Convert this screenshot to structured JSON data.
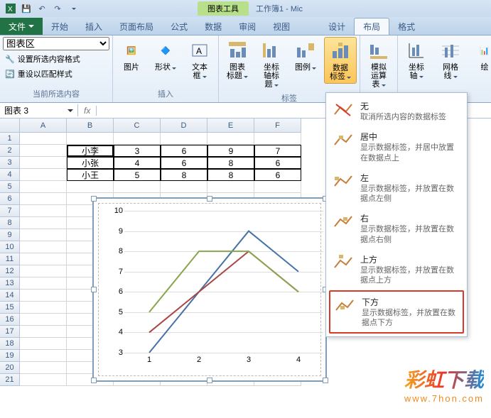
{
  "title": {
    "chart_tools": "图表工具",
    "workbook": "工作簿1 - Mic"
  },
  "tabs": {
    "file": "文件",
    "main": [
      "开始",
      "插入",
      "页面布局",
      "公式",
      "数据",
      "审阅",
      "视图"
    ],
    "chart": [
      "设计",
      "布局",
      "格式"
    ],
    "active": "布局"
  },
  "ribbon": {
    "sel": {
      "area": "图表区",
      "fmt": "设置所选内容格式",
      "reset": "重设以匹配样式",
      "label": "当前所选内容"
    },
    "insert": {
      "pic": "图片",
      "shape": "形状",
      "textbox": "文本框",
      "label": "插入"
    },
    "labels": {
      "title": "图表标题",
      "axistitle": "坐标轴标题",
      "legend": "图例",
      "datalabels": "数据标签",
      "label": "标签"
    },
    "analysis": {
      "table": "模拟运算表"
    },
    "axes": {
      "axis": "坐标轴",
      "grid": "网格线",
      "draw": "绘"
    }
  },
  "formula": {
    "namebox": "图表 3",
    "fx": "fx"
  },
  "cols": [
    "A",
    "B",
    "C",
    "D",
    "E",
    "F"
  ],
  "rows": [
    1,
    2,
    3,
    4,
    5,
    6,
    7,
    8,
    9,
    10,
    11,
    12,
    13,
    14,
    15,
    16,
    17,
    18,
    19,
    20,
    21
  ],
  "table": {
    "r2": [
      "",
      "小李",
      "3",
      "6",
      "9",
      "7"
    ],
    "r3": [
      "",
      "小张",
      "4",
      "6",
      "8",
      "6"
    ],
    "r4": [
      "",
      "小王",
      "5",
      "8",
      "8",
      "6"
    ]
  },
  "chart_data": {
    "type": "line",
    "categories": [
      "1",
      "2",
      "3",
      "4"
    ],
    "series": [
      {
        "name": "小李",
        "values": [
          3,
          6,
          9,
          7
        ],
        "color": "#4572a7"
      },
      {
        "name": "小张",
        "values": [
          4,
          6,
          8,
          6
        ],
        "color": "#aa4643"
      },
      {
        "name": "小王",
        "values": [
          5,
          8,
          8,
          6
        ],
        "color": "#89a54e"
      }
    ],
    "ylim": [
      3,
      10
    ],
    "yticks": [
      3,
      4,
      5,
      6,
      7,
      8,
      9,
      10
    ],
    "title": "",
    "xlabel": "",
    "ylabel": ""
  },
  "dropdown": [
    {
      "title": "无",
      "desc": "取消所选内容的数据标签"
    },
    {
      "title": "居中",
      "desc": "显示数据标签，并居中放置在数据点上"
    },
    {
      "title": "左",
      "desc": "显示数据标签，并放置在数据点左侧"
    },
    {
      "title": "右",
      "desc": "显示数据标签，并放置在数据点右侧"
    },
    {
      "title": "上方",
      "desc": "显示数据标签，并放置在数据点上方"
    },
    {
      "title": "下方",
      "desc": "显示数据标签，并放置在数据点下方"
    }
  ],
  "watermark": {
    "main": "彩虹下载",
    "sub": "www.7hon.com"
  }
}
